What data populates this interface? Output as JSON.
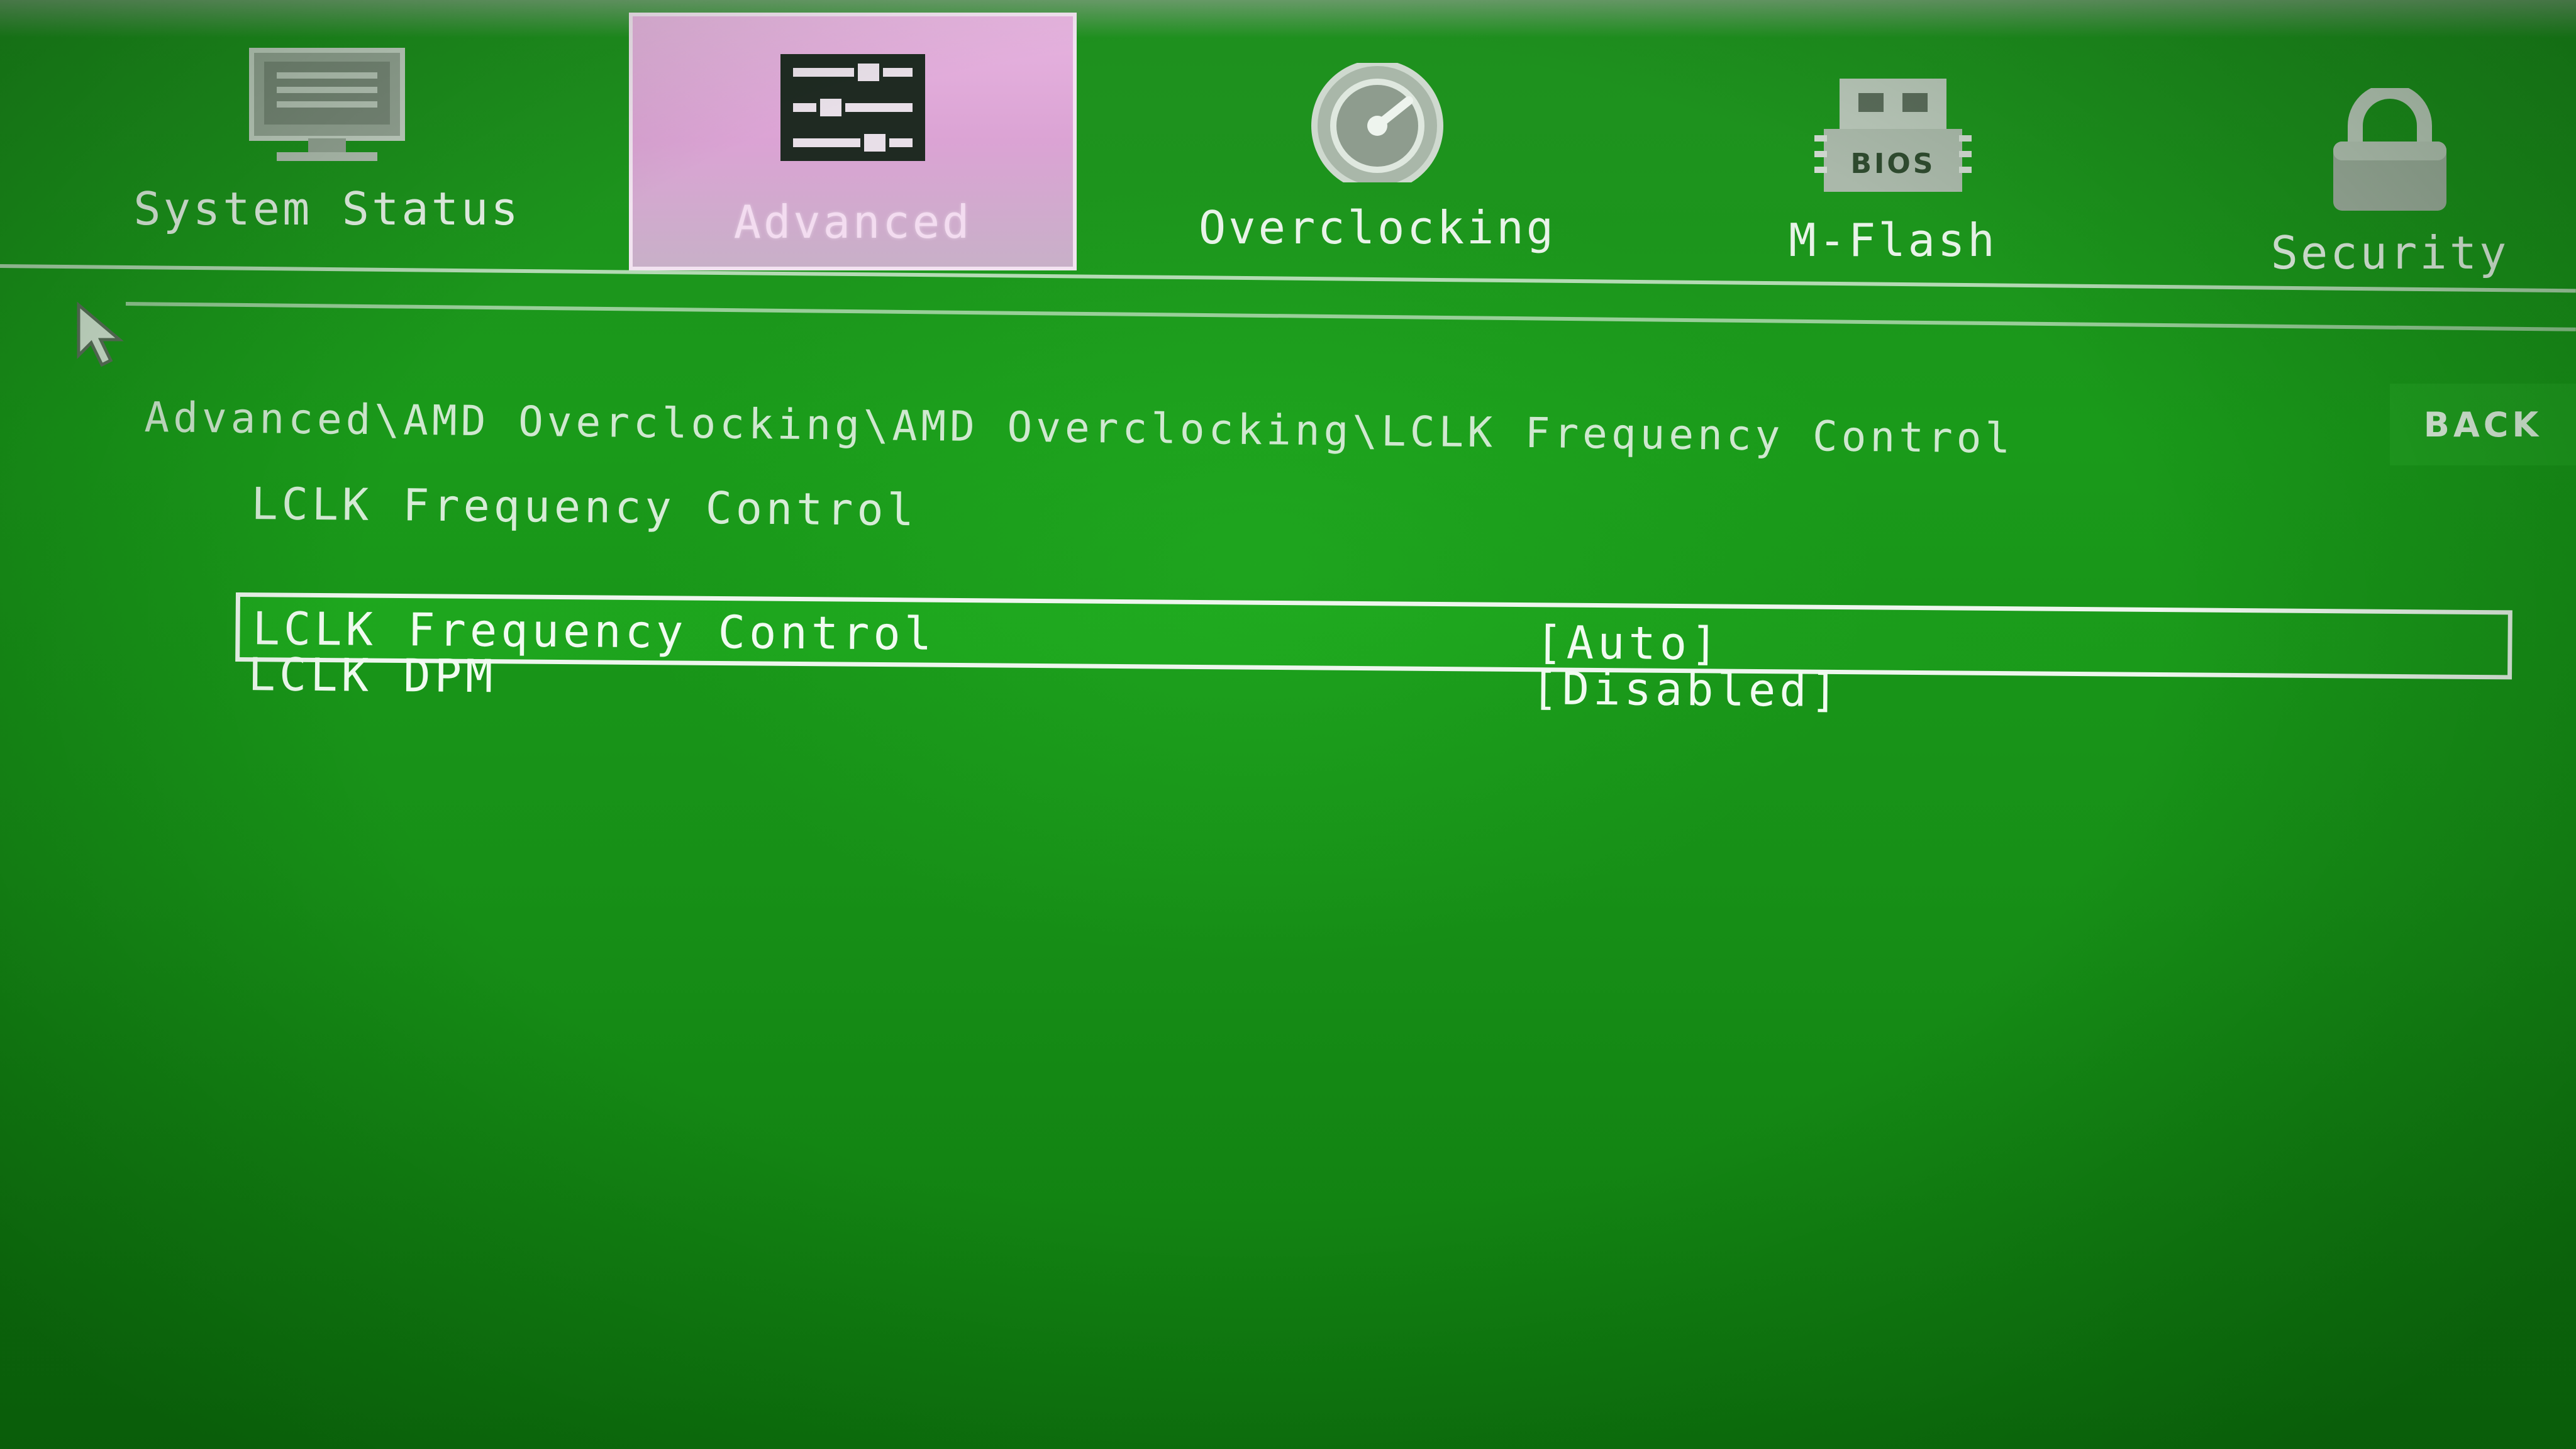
{
  "tabs": [
    {
      "label": "System Status",
      "icon": "monitor-icon",
      "active": false
    },
    {
      "label": "Advanced",
      "icon": "sliders-icon",
      "active": true
    },
    {
      "label": "Overclocking",
      "icon": "speedometer-icon",
      "active": false
    },
    {
      "label": "M-Flash",
      "icon": "bios-chip-icon",
      "active": false
    },
    {
      "label": "Security",
      "icon": "padlock-icon",
      "active": false
    }
  ],
  "bios_chip_text": "BIOS",
  "breadcrumb": "Advanced\\AMD Overclocking\\AMD Overclocking\\LCLK Frequency Control",
  "back_label": "BACK",
  "page_title": "LCLK Frequency Control",
  "settings": [
    {
      "name": "LCLK Frequency Control",
      "value": "[Auto]",
      "selected": true
    },
    {
      "name": "LCLK DPM",
      "value": "[Disabled]",
      "selected": false
    }
  ],
  "colors": {
    "background": "#1a9a1a",
    "active_tab": "#dba3d4",
    "text": "#e8f3e8"
  }
}
